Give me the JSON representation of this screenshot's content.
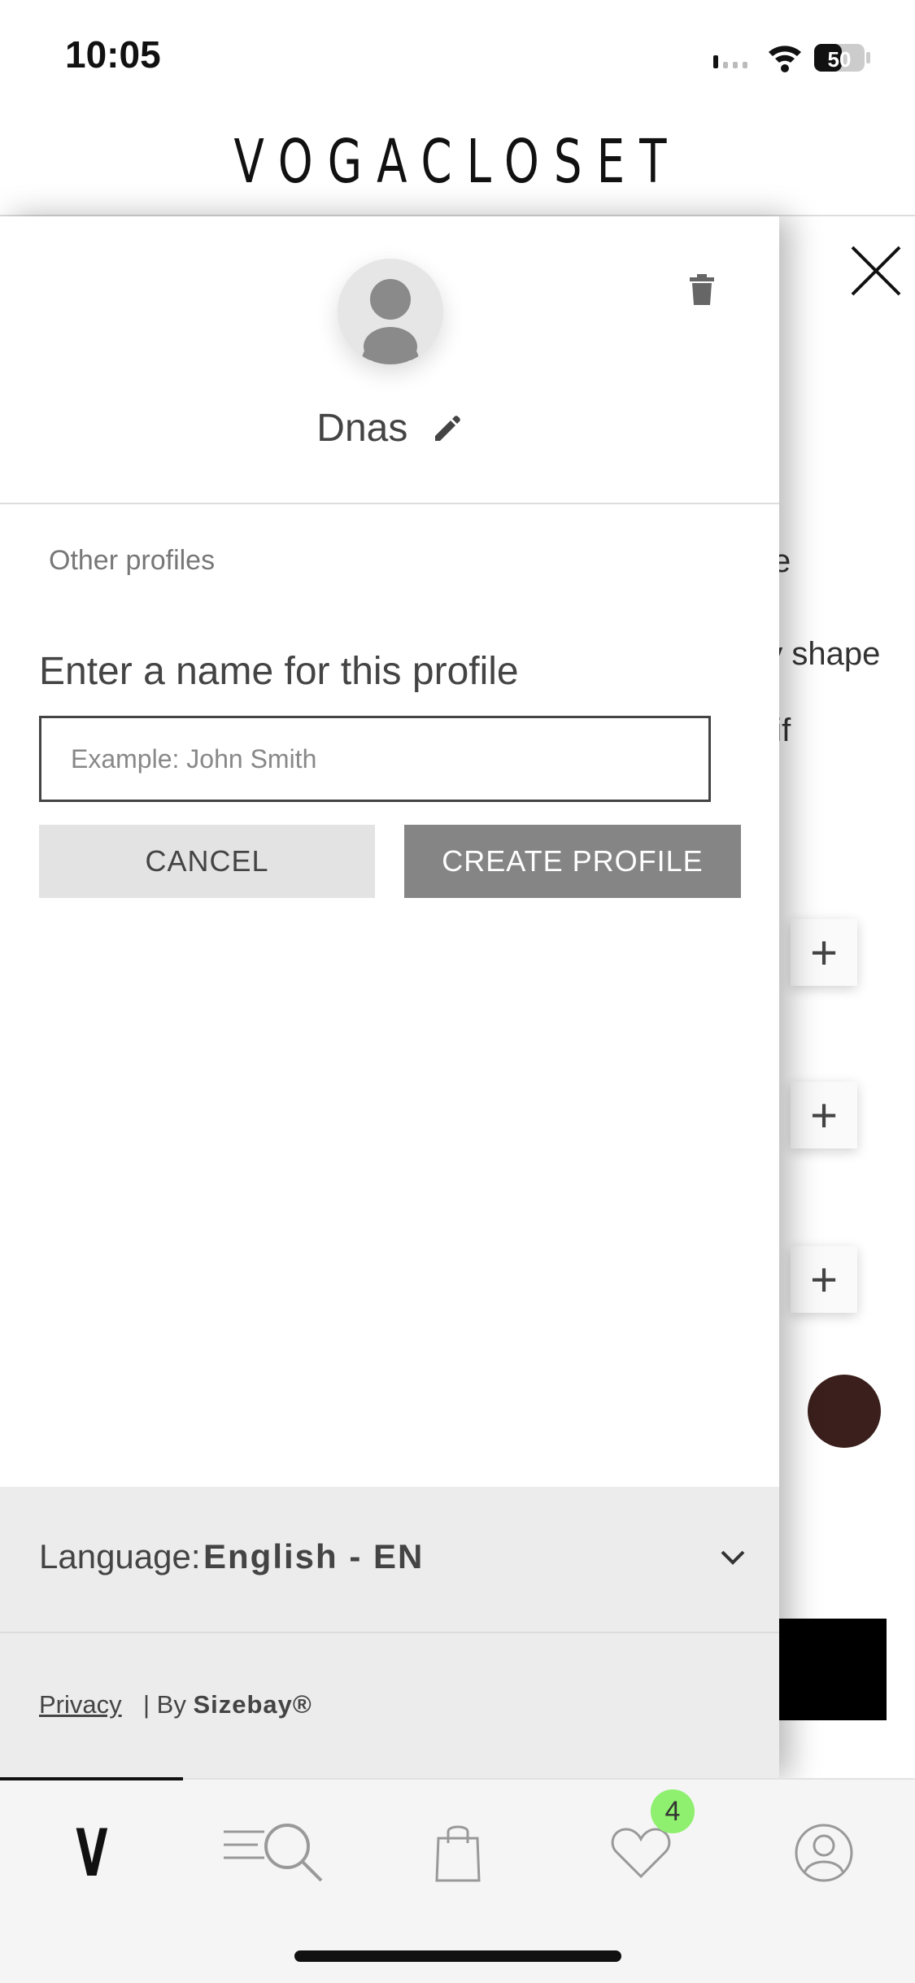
{
  "status_bar": {
    "time": "10:05",
    "battery": "50"
  },
  "header": {
    "brand": "VOGACLOSET"
  },
  "background_page": {
    "fragments": [
      "e",
      "dy shape",
      "/ if"
    ],
    "plus_label": "+"
  },
  "profile_panel": {
    "profile_name": "Dnas",
    "other_profiles_label": "Other profiles",
    "name_prompt": "Enter a name for this profile",
    "name_input": {
      "placeholder": "Example: John Smith",
      "value": ""
    },
    "cancel_label": "CANCEL",
    "create_label": "CREATE PROFILE",
    "language_label": "Language:",
    "language_value": "English - EN",
    "privacy_label": "Privacy",
    "by_label": "| By",
    "provider_label": "Sizebay®"
  },
  "tab_bar": {
    "home_glyph": "V",
    "wishlist_count": "4",
    "items": [
      "home",
      "menu-search",
      "bag",
      "wishlist",
      "account"
    ]
  },
  "colors": {
    "create_button": "#858585",
    "cancel_button": "#e3e3e4",
    "badge": "#8ef06e",
    "swatch": "#3a1f1c"
  }
}
